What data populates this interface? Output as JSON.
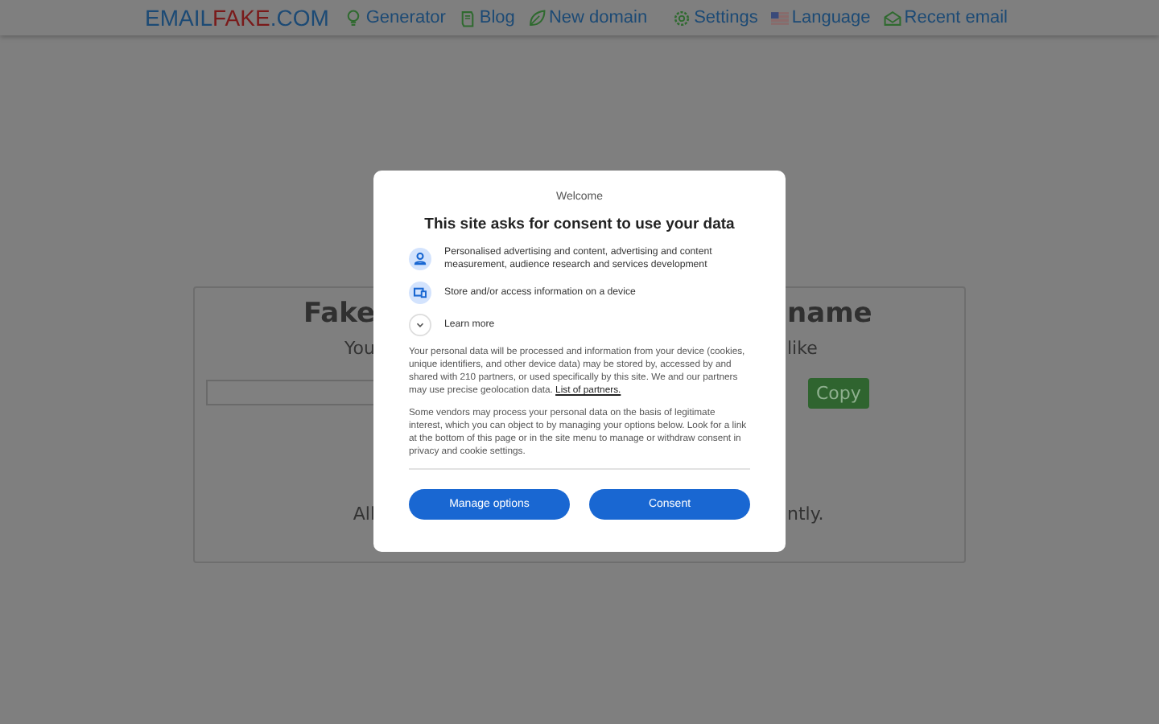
{
  "header": {
    "logo": {
      "part_1": "EMAIL",
      "part_2": "FAKE",
      "part_3": ".COM"
    },
    "nav_left": [
      {
        "label": "Generator"
      },
      {
        "label": "Blog"
      },
      {
        "label": "New domain"
      }
    ],
    "nav_right": [
      {
        "label": "Settings"
      },
      {
        "label": "Language"
      },
      {
        "label": "Recent email"
      }
    ]
  },
  "card": {
    "title_left": "Fake",
    "title_right": "name",
    "subtitle_left": "You",
    "subtitle_right": "like",
    "copy_button": "Copy",
    "footer_left": "All",
    "footer_right": "ntly."
  },
  "consent_dialog": {
    "welcome": "Welcome",
    "title": "This site asks for consent to use your data",
    "purposes": [
      {
        "text": "Personalised advertising and content, advertising and content measurement, audience research and services development"
      },
      {
        "text": "Store and/or access information on a device"
      },
      {
        "text": "Learn more"
      }
    ],
    "paragraph_1": "Your personal data will be processed and information from your device (cookies, unique identifiers, and other device data) may be stored by, accessed by and shared with 210 partners, or used specifically by this site. We and our partners may use precise geolocation data.",
    "partners_link": "List of partners.",
    "paragraph_2": "Some vendors may process your personal data on the basis of legitimate interest, which you can object to by managing your options below. Look for a link at the bottom of this page or in the site menu to manage or withdraw consent in privacy and cookie settings.",
    "buttons": [
      "Manage options",
      "Consent"
    ]
  }
}
